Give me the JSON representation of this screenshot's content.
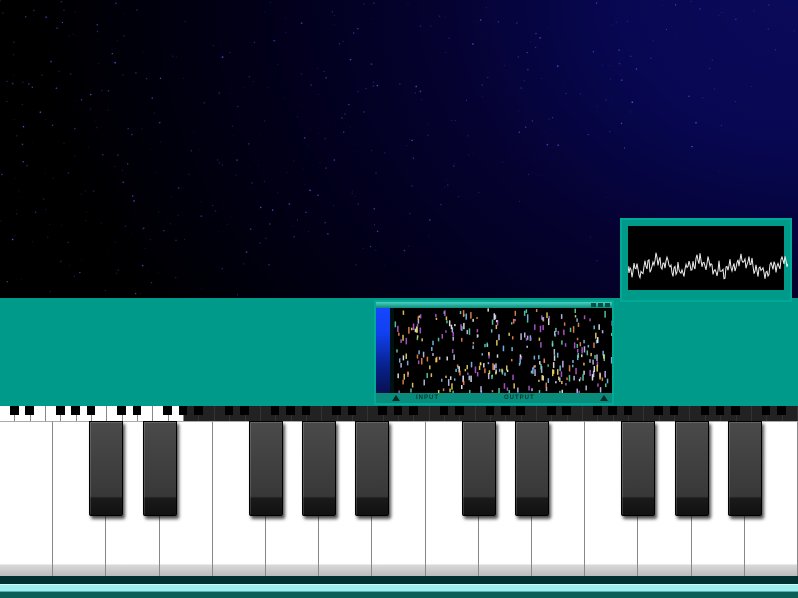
{
  "sequencer": {
    "input_label": "INPUT",
    "output_label": "OUTPUT"
  },
  "keyboard": {
    "white_key_count": 15,
    "black_key_pattern": [
      0,
      1,
      1,
      0,
      1,
      1,
      1,
      0,
      1,
      1,
      0,
      1,
      1,
      1
    ]
  },
  "mini_keyboard": {
    "total_keys": 52,
    "visible_range_start": 0,
    "visible_range_end": 12
  },
  "colors": {
    "accent": "#009a8a",
    "panel": "#0a8c7d"
  }
}
